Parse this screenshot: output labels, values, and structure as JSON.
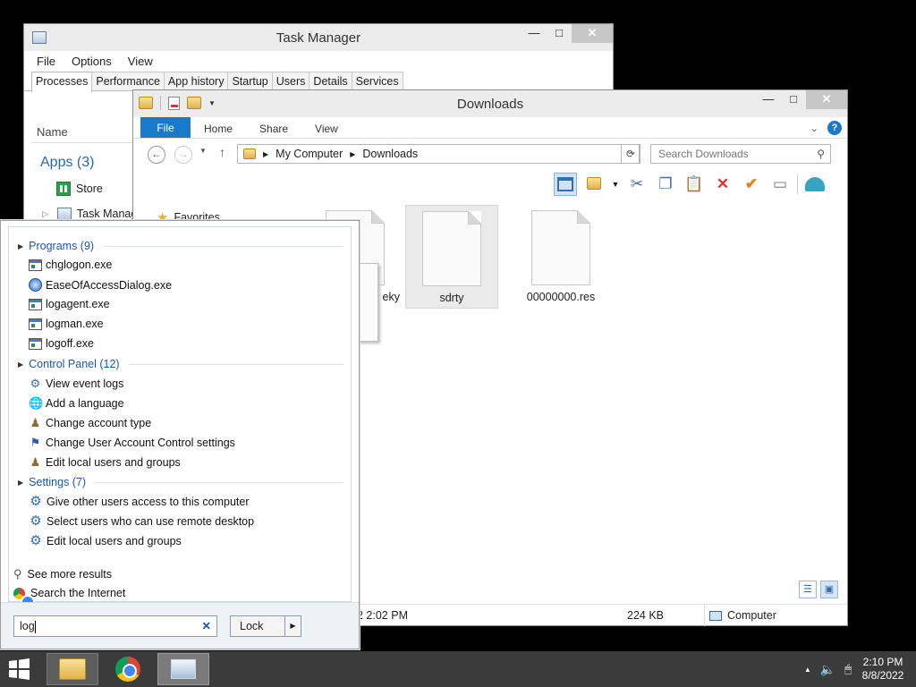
{
  "task_manager": {
    "title": "Task Manager",
    "menu": [
      "File",
      "Options",
      "View"
    ],
    "tabs": [
      "Processes",
      "Performance",
      "App history",
      "Startup",
      "Users",
      "Details",
      "Services"
    ],
    "column_name": "Name",
    "apps_group": "Apps (3)",
    "rows": [
      "Store",
      "Task Manag"
    ]
  },
  "explorer": {
    "title": "Downloads",
    "ribbon_tabs": [
      "File",
      "Home",
      "Share",
      "View"
    ],
    "breadcrumb": [
      "My Computer",
      "Downloads"
    ],
    "search_placeholder": "Search Downloads",
    "nav_favorites": "Favorites",
    "files": [
      {
        "name": "eky",
        "selected": false
      },
      {
        "name": "sdrty",
        "selected": true
      },
      {
        "name": "00000000.res",
        "selected": false
      }
    ],
    "status": {
      "date": "2 2:02 PM",
      "size": "224 KB",
      "location": "Computer"
    }
  },
  "search_flyout": {
    "groups": [
      {
        "label": "Programs (9)",
        "items": [
          {
            "label": "chglogon.exe",
            "icon": "exe-icon"
          },
          {
            "label": "EaseOfAccessDialog.exe",
            "icon": "ease-of-access-icon"
          },
          {
            "label": "logagent.exe",
            "icon": "exe-icon"
          },
          {
            "label": "logman.exe",
            "icon": "exe-icon"
          },
          {
            "label": "logoff.exe",
            "icon": "exe-icon"
          }
        ]
      },
      {
        "label": "Control Panel (12)",
        "items": [
          {
            "label": "View event logs",
            "icon": "event-viewer-icon"
          },
          {
            "label": "Add a language",
            "icon": "language-icon"
          },
          {
            "label": "Change account type",
            "icon": "users-icon"
          },
          {
            "label": "Change User Account Control settings",
            "icon": "uac-flag-icon"
          },
          {
            "label": "Edit local users and groups",
            "icon": "users-icon"
          }
        ]
      },
      {
        "label": "Settings (7)",
        "items": [
          {
            "label": "Give other users access to this computer",
            "icon": "gear-icon"
          },
          {
            "label": "Select users who can use remote desktop",
            "icon": "gear-icon"
          },
          {
            "label": "Edit local users and groups",
            "icon": "gear-icon"
          }
        ]
      }
    ],
    "see_more": "See more results",
    "search_internet": "Search the Internet",
    "query": "log",
    "lock_label": "Lock"
  },
  "taskbar": {
    "time": "2:10 PM",
    "date": "8/8/2022"
  }
}
